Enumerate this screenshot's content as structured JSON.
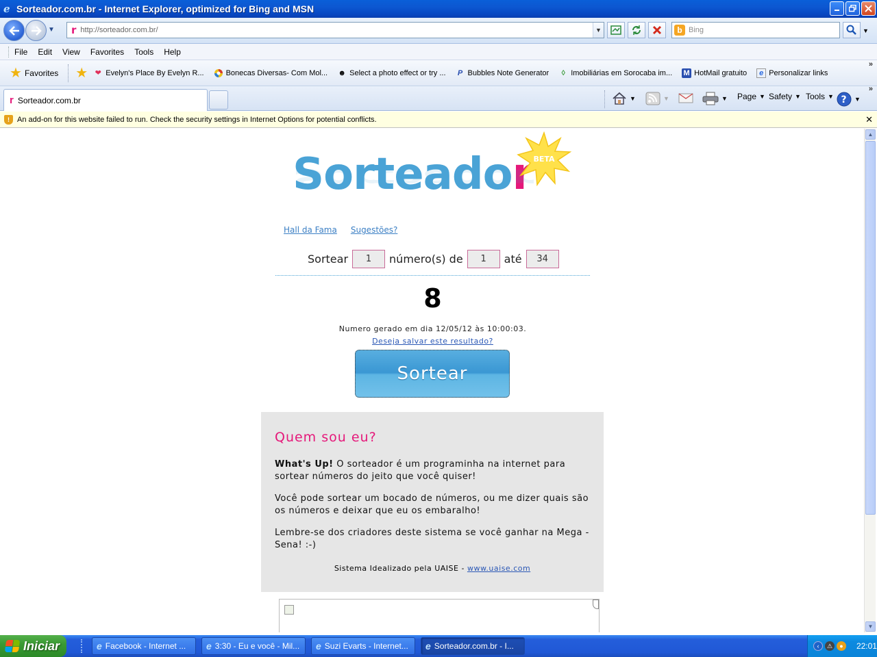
{
  "window": {
    "title": "Sorteador.com.br - Internet Explorer, optimized for Bing and MSN"
  },
  "nav": {
    "url": "http://sorteador.com.br/",
    "search_placeholder": "Bing"
  },
  "menu": [
    "File",
    "Edit",
    "View",
    "Favorites",
    "Tools",
    "Help"
  ],
  "favorites": {
    "label": "Favorites",
    "links": [
      "Evelyn's Place  By Evelyn R...",
      "Bonecas Diversas- Com Mol...",
      "Select a photo effect or try ...",
      "Bubbles Note Generator",
      "Imobiliárias em Sorocaba im...",
      "HotMail gratuito",
      "Personalizar links"
    ]
  },
  "tab": {
    "title": "Sorteador.com.br"
  },
  "commands": {
    "page": "Page",
    "safety": "Safety",
    "tools": "Tools"
  },
  "infobar": {
    "message": "An add-on for this website failed to run. Check the security settings in Internet Options for potential conflicts."
  },
  "page": {
    "logo": "Sortea",
    "logo_r": "r",
    "logo_mid": "do",
    "beta": "BETA",
    "links": [
      "Hall da Fama",
      "Sugestões?"
    ],
    "form": {
      "label_sortear": "Sortear",
      "qty": "1",
      "label_numeros": "número(s) de",
      "from": "1",
      "label_ate": "até",
      "to": "34"
    },
    "result": "8",
    "generated": "Numero gerado em dia 12/05/12 às 10:00:03.",
    "save_link": "Deseja salvar este resultado?",
    "button": "Sortear",
    "about": {
      "heading": "Quem sou eu?",
      "p1_bold": "What's Up!",
      "p1": " O sorteador é um programinha na internet para sortear números do jeito que você quiser!",
      "p2": "Você pode sortear um bocado de números, ou me dizer quais são os números e deixar que eu os embaralho!",
      "p3": "Lembre-se dos criadores deste sistema se você ganhar na Mega -Sena! :-)",
      "credit": "Sistema Idealizado pela UAISE - ",
      "credit_link": "www.uaise.com"
    }
  },
  "taskbar": {
    "start": "Iniciar",
    "tasks": [
      "Facebook - Internet ...",
      "3:30 - Eu e você - Mil...",
      "Suzi Evarts - Internet...",
      "Sorteador.com.br - I..."
    ],
    "clock": "22:01"
  },
  "colors": {
    "accent_pink": "#e5187a",
    "accent_blue": "#4aa3d6",
    "xp_blue": "#245edb"
  }
}
